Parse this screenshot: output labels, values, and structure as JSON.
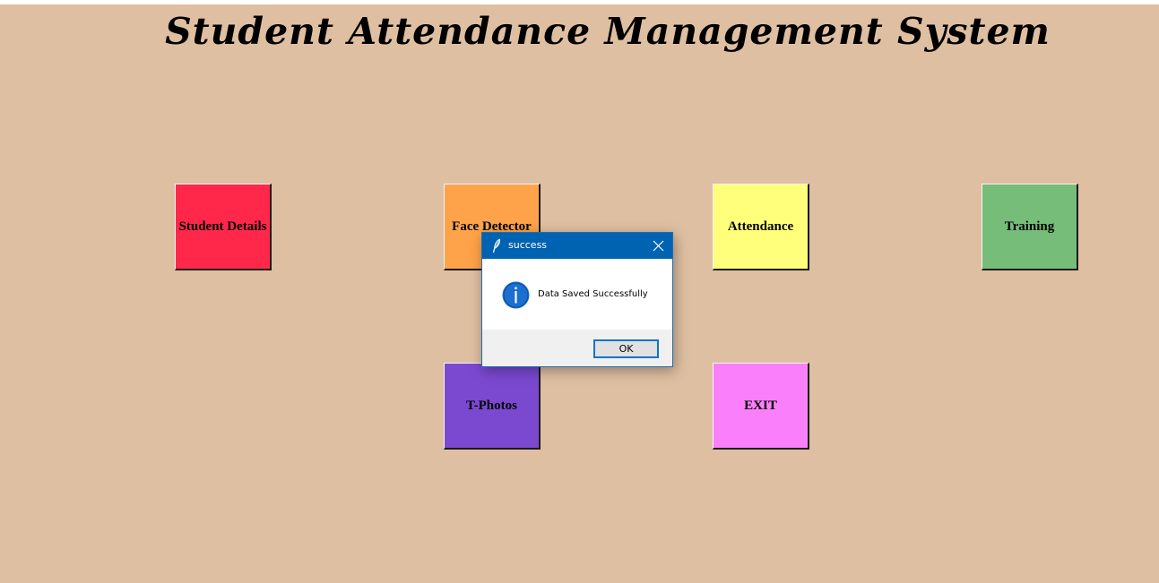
{
  "app": {
    "title": "Student Attendance Management System",
    "background_color": "#dfbfa1"
  },
  "tiles": [
    {
      "id": "student-details",
      "label": "Student Details",
      "color": "#ff284a"
    },
    {
      "id": "face-detector",
      "label": "Face Detector",
      "color": "#ffa34a"
    },
    {
      "id": "attendance",
      "label": "Attendance",
      "color": "#ffff7b"
    },
    {
      "id": "training",
      "label": "Training",
      "color": "#76bd7a"
    },
    {
      "id": "t-photos",
      "label": "T-Photos",
      "color": "#7b49d0"
    },
    {
      "id": "exit",
      "label": "EXIT",
      "color": "#fa80fb"
    }
  ],
  "dialog": {
    "title": "success",
    "message": "Data Saved Successfully",
    "ok_label": "OK",
    "titlebar_color": "#0063b1",
    "icons": [
      "feather-icon",
      "close-icon",
      "info-icon"
    ]
  }
}
